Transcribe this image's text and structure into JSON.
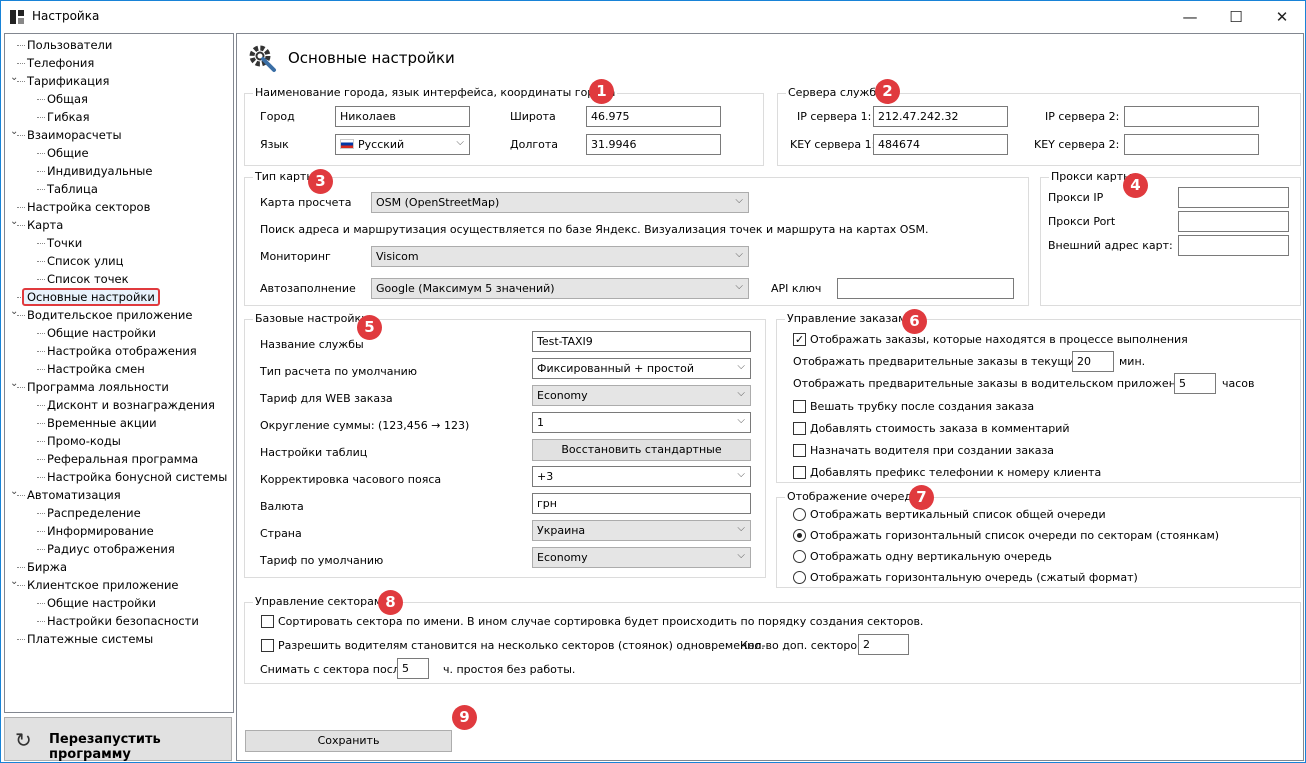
{
  "window": {
    "title": "Настройка",
    "minimize": "—",
    "maximize": "☐",
    "close": "✕"
  },
  "sidebar": {
    "items": [
      {
        "label": "Пользователи",
        "level": 0
      },
      {
        "label": "Телефония",
        "level": 0
      },
      {
        "label": "Тарификация",
        "level": 0,
        "expanded": true
      },
      {
        "label": "Общая",
        "level": 1
      },
      {
        "label": "Гибкая",
        "level": 1
      },
      {
        "label": "Взаиморасчеты",
        "level": 0,
        "expanded": true
      },
      {
        "label": "Общие",
        "level": 1
      },
      {
        "label": "Индивидуальные",
        "level": 1
      },
      {
        "label": "Таблица",
        "level": 1
      },
      {
        "label": "Настройка секторов",
        "level": 0
      },
      {
        "label": "Карта",
        "level": 0,
        "expanded": true
      },
      {
        "label": "Точки",
        "level": 1
      },
      {
        "label": "Список улиц",
        "level": 1
      },
      {
        "label": "Список точек",
        "level": 1
      },
      {
        "label": "Основные настройки",
        "level": 0,
        "selected": true
      },
      {
        "label": "Водительское приложение",
        "level": 0,
        "expanded": true
      },
      {
        "label": "Общие настройки",
        "level": 1
      },
      {
        "label": "Настройка отображения",
        "level": 1
      },
      {
        "label": "Настройка смен",
        "level": 1
      },
      {
        "label": "Программа лояльности",
        "level": 0,
        "expanded": true
      },
      {
        "label": "Дисконт и вознаграждения",
        "level": 1
      },
      {
        "label": "Временные акции",
        "level": 1
      },
      {
        "label": "Промо-коды",
        "level": 1
      },
      {
        "label": "Реферальная программа",
        "level": 1
      },
      {
        "label": "Настройка бонусной системы",
        "level": 1
      },
      {
        "label": "Автоматизация",
        "level": 0,
        "expanded": true
      },
      {
        "label": "Распределение",
        "level": 1
      },
      {
        "label": "Информирование",
        "level": 1
      },
      {
        "label": "Радиус отображения",
        "level": 1
      },
      {
        "label": "Биржа",
        "level": 0
      },
      {
        "label": "Клиентское приложение",
        "level": 0,
        "expanded": true
      },
      {
        "label": "Общие настройки",
        "level": 1
      },
      {
        "label": "Настройки безопасности",
        "level": 1
      },
      {
        "label": "Платежные системы",
        "level": 0
      }
    ],
    "restart_label": "Перезапустить программу"
  },
  "main": {
    "title": "Основные настройки"
  },
  "city": {
    "group_title": "Наименование города, язык интерфейса, координаты города",
    "city_label": "Город",
    "city_value": "Николаев",
    "lang_label": "Язык",
    "lang_value": "Русский",
    "lat_label": "Широта",
    "lat_value": "46.975",
    "lon_label": "Долгота",
    "lon_value": "31.9946"
  },
  "servers": {
    "group_title": "Сервера службы",
    "ip1_label": "IP сервера 1:",
    "ip1_value": "212.47.242.32",
    "key1_label": "KEY сервера 1:",
    "key1_value": "484674",
    "ip2_label": "IP сервера 2:",
    "ip2_value": "",
    "key2_label": "KEY сервера 2:",
    "key2_value": ""
  },
  "map": {
    "group_title": "Тип карты",
    "view_label": "Карта просчета",
    "view_value": "OSM (OpenStreetMap)",
    "info": "Поиск адреса и маршрутизация осуществляется по базе Яндекс. Визуализация точек и маршрута на картах OSM.",
    "monitor_label": "Мониторинг",
    "monitor_value": "Visicom",
    "autofill_label": "Автозаполнение",
    "autofill_value": "Google (Максимум 5 значений)",
    "api_label": "API ключ",
    "api_value": ""
  },
  "proxy": {
    "group_title": "Прокси карты",
    "ip_label": "Прокси IP",
    "port_label": "Прокси Port",
    "ext_label": "Внешний адрес карт:"
  },
  "base": {
    "group_title": "Базовые настройки",
    "service_label": "Название службы",
    "service_value": "Test-TAXI9",
    "calc_label": "Тип расчета по умолчанию",
    "calc_value": "Фиксированный + простой",
    "web_label": "Тариф для WEB заказа",
    "web_value": "Economy",
    "round_label": "Округление суммы:  (123,456  → 123)",
    "round_value": "1",
    "tables_label": "Настройки таблиц",
    "tables_button": "Восстановить стандартные параметры",
    "tz_label": "Корректировка часового пояса",
    "tz_value": "+3",
    "currency_label": "Валюта",
    "currency_value": "грн",
    "country_label": "Страна",
    "country_value": "Украина",
    "tariff_label": "Тариф по умолчанию",
    "tariff_value": "Economy"
  },
  "orders": {
    "group_title": "Управление заказами",
    "show_in_progress": "Отображать заказы, которые находятся в процессе выполнения",
    "prelim_current_label": "Отображать предварительные заказы в текущих за",
    "prelim_current_value": "20",
    "prelim_current_unit": "мин.",
    "prelim_driver_label": "Отображать предварительные заказы в водительском приложении за",
    "prelim_driver_value": "5",
    "prelim_driver_unit": "часов",
    "hangup": "Вешать трубку после создания заказа",
    "add_cost": "Добавлять стоимость заказа в комментарий",
    "assign_driver": "Назначать водителя при создании заказа",
    "add_prefix": "Добавлять префикс телефонии к номеру клиента"
  },
  "queue": {
    "group_title": "Отображение очереди",
    "opt1": "Отображать вертикальный список общей очереди",
    "opt2": "Отображать горизонтальный список очереди по секторам (стоянкам)",
    "opt3": "Отображать одну вертикальную очередь",
    "opt4": "Отображать горизонтальную очередь (сжатый формат)"
  },
  "sectors": {
    "group_title": "Управление секторами",
    "sort_label": "Сортировать сектора по имени. В ином случае сортировка будет происходить по порядку создания секторов.",
    "multi_label": "Разрешить водителям становится на несколько секторов (стоянок) одновременно.",
    "count_label": "Кол-во доп. секторов:",
    "count_value": "2",
    "remove_label": "Снимать с сектора после",
    "remove_value": "5",
    "remove_unit": "ч. простоя без работы."
  },
  "save_label": "Сохранить",
  "badges": [
    "1",
    "2",
    "3",
    "4",
    "5",
    "6",
    "7",
    "8",
    "9"
  ],
  "colors": {
    "badge": "#e03a3e",
    "selection_border": "#e03a3e",
    "window_border": "#1883d7"
  }
}
